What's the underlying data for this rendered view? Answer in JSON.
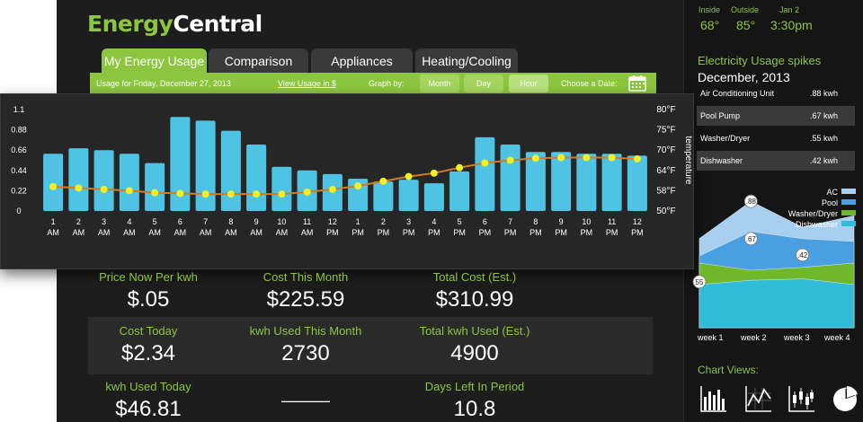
{
  "app": {
    "logo_part1": "Energy",
    "logo_part2": "Central"
  },
  "tabs": [
    {
      "label": "My Energy Usage"
    },
    {
      "label": "Comparison"
    },
    {
      "label": "Appliances"
    },
    {
      "label": "Heating/Cooling"
    }
  ],
  "toolbar": {
    "usage_for": "Usage for Friday, December 27, 2013",
    "view_link": "View Usage in $",
    "graph_by": "Graph by:",
    "btn_month": "Month",
    "btn_day": "Day",
    "btn_hour": "Hour",
    "choose_date": "Choose a Date:"
  },
  "chart_data": {
    "type": "bar",
    "categories": [
      "1 AM",
      "2 AM",
      "3 AM",
      "4 AM",
      "5 AM",
      "6 AM",
      "7 AM",
      "8 AM",
      "9 AM",
      "10 AM",
      "11 AM",
      "12 PM",
      "1 PM",
      "2 PM",
      "3 PM",
      "4 PM",
      "5 PM",
      "6 PM",
      "7 PM",
      "8 PM",
      "9 PM",
      "10 PM",
      "11 PM",
      "12 PM"
    ],
    "x_top": [
      "1",
      "2",
      "3",
      "4",
      "5",
      "6",
      "7",
      "8",
      "9",
      "10",
      "11",
      "12",
      "1",
      "2",
      "3",
      "4",
      "5",
      "6",
      "7",
      "8",
      "9",
      "10",
      "11",
      "12"
    ],
    "x_bottom": [
      "AM",
      "AM",
      "AM",
      "AM",
      "AM",
      "AM",
      "AM",
      "AM",
      "AM",
      "AM",
      "AM",
      "PM",
      "PM",
      "PM",
      "PM",
      "PM",
      "PM",
      "PM",
      "PM",
      "PM",
      "PM",
      "PM",
      "PM",
      "PM"
    ],
    "series": [
      {
        "values": [
          0.62,
          0.68,
          0.66,
          0.62,
          0.52,
          1.02,
          0.98,
          0.87,
          0.72,
          0.48,
          0.44,
          0.4,
          0.35,
          0.32,
          0.34,
          0.3,
          0.43,
          0.8,
          0.72,
          0.64,
          0.64,
          0.62,
          0.62,
          0.6
        ]
      },
      {
        "values": [
          57.2,
          56.8,
          56.4,
          56.0,
          55.4,
          55.2,
          55.0,
          55.0,
          55.0,
          55.0,
          55.6,
          56.4,
          57.4,
          58.8,
          60.2,
          61.2,
          62.8,
          64.2,
          65.0,
          65.6,
          65.8,
          65.8,
          65.8,
          65.4
        ]
      }
    ],
    "y_left_ticks": [
      "1.1",
      "0.88",
      "0.66",
      "0.44",
      "0.22",
      "0"
    ],
    "y_right_ticks": [
      "80°F",
      "75°F",
      "70°F",
      "64°F",
      "58°F",
      "50°F"
    ],
    "ylabel_right": "temperature",
    "ylim_left": [
      0,
      1.1
    ],
    "ylim_right": [
      50,
      80
    ],
    "colors": {
      "bars": "#4fc3e3",
      "line": "#d87a1c",
      "points": "#f3ef25"
    }
  },
  "stats": {
    "row1": [
      {
        "label": "Price Now Per kwh",
        "value": "$.05"
      },
      {
        "label": "Cost This Month",
        "value": "$225.59"
      },
      {
        "label": "Total Cost (Est.)",
        "value": "$310.99"
      }
    ],
    "row2": [
      {
        "label": "Cost Today",
        "value": "$2.34"
      },
      {
        "label": "kwh Used This Month",
        "value": "2730"
      },
      {
        "label": "Total kwh Used (Est.)",
        "value": "4900"
      }
    ],
    "row3": [
      {
        "label": "kwh Used Today",
        "value": "$46.81"
      },
      {
        "label": "",
        "value": "———"
      },
      {
        "label": "Days Left In Period",
        "value": "10.8"
      }
    ]
  },
  "weather": {
    "inside_label": "Inside",
    "inside_value": "68°",
    "outside_label": "Outside",
    "outside_value": "85°",
    "date_label": "Jan 2",
    "time_value": "3:30pm"
  },
  "spikes": {
    "title": "Electricity Usage spikes",
    "subtitle": "December, 2013",
    "items": [
      {
        "name": "Air Conditioning Unit",
        "value": ".88 kwh"
      },
      {
        "name": "Pool Pump",
        "value": ".67 kwh"
      },
      {
        "name": "Washer/Dryer",
        "value": ".55 kwh"
      },
      {
        "name": "Dishwasher",
        "value": ".42 kwh"
      }
    ]
  },
  "area_chart": {
    "type": "area",
    "categories": [
      "week 1",
      "week 2",
      "week 3",
      "week 4"
    ],
    "legend": [
      "AC",
      "Pool",
      "Washer/Dryer",
      "Dishwasher"
    ],
    "colors": [
      "#a9cff0",
      "#4a9fe0",
      "#6fb82a",
      "#2fbcd8"
    ],
    "series": [
      {
        "name": "AC",
        "values": [
          0.62,
          0.88,
          0.7,
          0.78
        ]
      },
      {
        "name": "Pool",
        "values": [
          0.5,
          0.67,
          0.62,
          0.6
        ]
      },
      {
        "name": "Washer/Dryer",
        "values": [
          0.45,
          0.4,
          0.42,
          0.45
        ]
      },
      {
        "name": "Dishwasher",
        "values": [
          0.3,
          0.33,
          0.34,
          0.3
        ]
      }
    ],
    "point_labels": [
      "55",
      ".88",
      ".67",
      ".42"
    ]
  },
  "chart_views": {
    "title": "Chart Views:",
    "icons": [
      "histogram-icon",
      "line-chart-icon",
      "candlestick-icon",
      "pie-chart-icon"
    ]
  }
}
